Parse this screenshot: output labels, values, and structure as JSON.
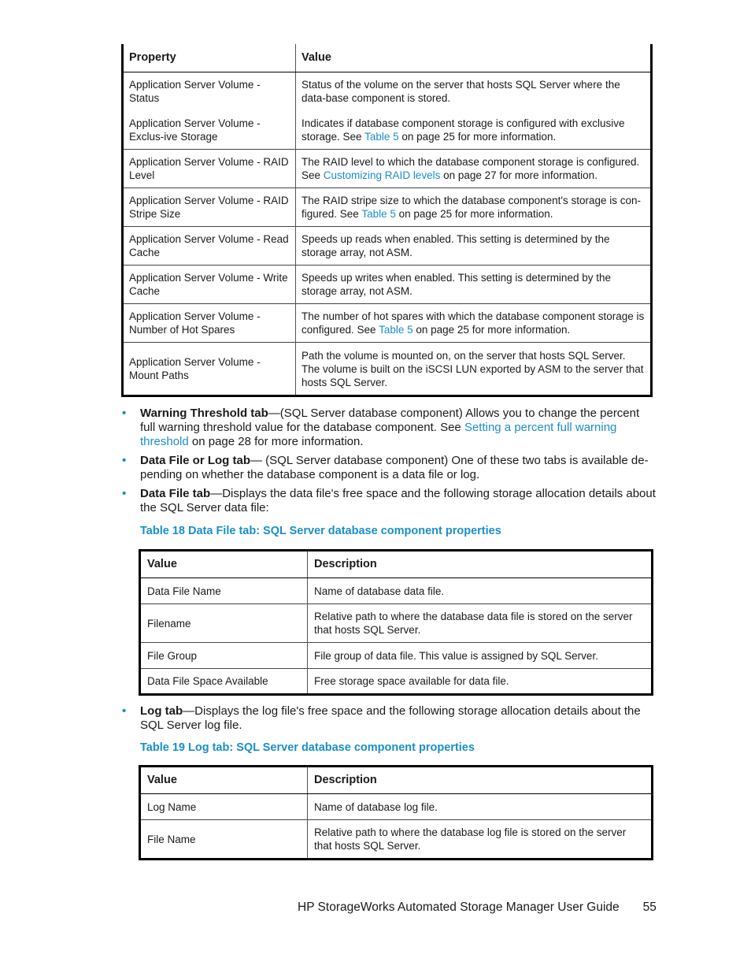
{
  "properties_table": {
    "headers": [
      "Property",
      "Value"
    ],
    "rows": [
      {
        "property": "Application Server Volume - Status",
        "value_pre": "Status of the volume on the server that hosts SQL Server where the data-base component is stored.",
        "link": "",
        "value_post": ""
      },
      {
        "property": "Application Server Volume - Exclus-ive Storage",
        "value_pre": "Indicates if database component storage is configured with exclusive storage. See ",
        "link": "Table 5",
        "value_post": " on page 25 for more information."
      },
      {
        "property": "Application Server Volume - RAID Level",
        "value_pre": "The RAID level to which the database component storage is configured. See ",
        "link": "Customizing RAID levels",
        "value_post": " on page 27 for more information."
      },
      {
        "property": "Application Server Volume - RAID Stripe Size",
        "value_pre": "The RAID stripe size to which the database component's storage is con-figured. See ",
        "link": "Table 5",
        "value_post": " on page 25 for more information."
      },
      {
        "property": "Application Server Volume - Read Cache",
        "value_pre": "Speeds up reads when enabled. This setting is determined by the storage array, not ASM.",
        "link": "",
        "value_post": ""
      },
      {
        "property": "Application Server Volume - Write Cache",
        "value_pre": "Speeds up writes when enabled. This setting is determined by the storage array, not ASM.",
        "link": "",
        "value_post": ""
      },
      {
        "property": "Application Server Volume - Number of Hot Spares",
        "value_pre": "The number of hot spares with which the database component storage is configured. See ",
        "link": "Table 5",
        "value_post": " on page 25 for more information."
      },
      {
        "property": "Application Server Volume - Mount Paths",
        "value_pre": "Path the volume is mounted on, on the server that hosts SQL Server. The volume is built on the iSCSI LUN exported by ASM to the server that hosts SQL Server.",
        "link": "",
        "value_post": ""
      }
    ]
  },
  "bullets": [
    {
      "term": "Warning Threshold tab",
      "text_pre": "—(SQL Server database component) Allows you to change the percent full warning threshold value for the database component. See ",
      "link": "Setting a percent full warning threshold",
      "text_post": " on page 28 for more information."
    },
    {
      "term": "Data File or Log tab",
      "text_pre": "— (SQL Server database component) One of these two tabs is available de-pending on whether the database component is a data file or log.",
      "link": "",
      "text_post": ""
    },
    {
      "term": "Data File tab",
      "text_pre": "—Displays the data file's free space and the following storage allocation details about the SQL Server data file:",
      "link": "",
      "text_post": ""
    },
    {
      "term": "Log tab",
      "text_pre": "—Displays the log file's free space and the following storage allocation details about the SQL Server log file.",
      "link": "",
      "text_post": ""
    }
  ],
  "bullet_glyph": "•",
  "table18": {
    "caption": "Table 18 Data File tab: SQL Server database component properties",
    "headers": [
      "Value",
      "Description"
    ],
    "rows": [
      [
        "Data File Name",
        "Name of database data file."
      ],
      [
        "Filename",
        "Relative path to where the database data file is stored on the server that hosts SQL Server."
      ],
      [
        "File Group",
        "File group of data file. This value is assigned by SQL Server."
      ],
      [
        "Data File Space Available",
        "Free storage space available for data file."
      ]
    ]
  },
  "table19": {
    "caption": "Table 19 Log tab: SQL Server database component properties",
    "headers": [
      "Value",
      "Description"
    ],
    "rows": [
      [
        "Log Name",
        "Name of database log file."
      ],
      [
        "File Name",
        "Relative path to where the database log file is stored on the server that hosts SQL Server."
      ]
    ]
  },
  "footer": {
    "title": "HP StorageWorks Automated Storage Manager User Guide",
    "page_number": "55"
  },
  "colors": {
    "link": "#1a8fc9",
    "caption": "#1a8fc9",
    "text": "#1a1a1a"
  }
}
